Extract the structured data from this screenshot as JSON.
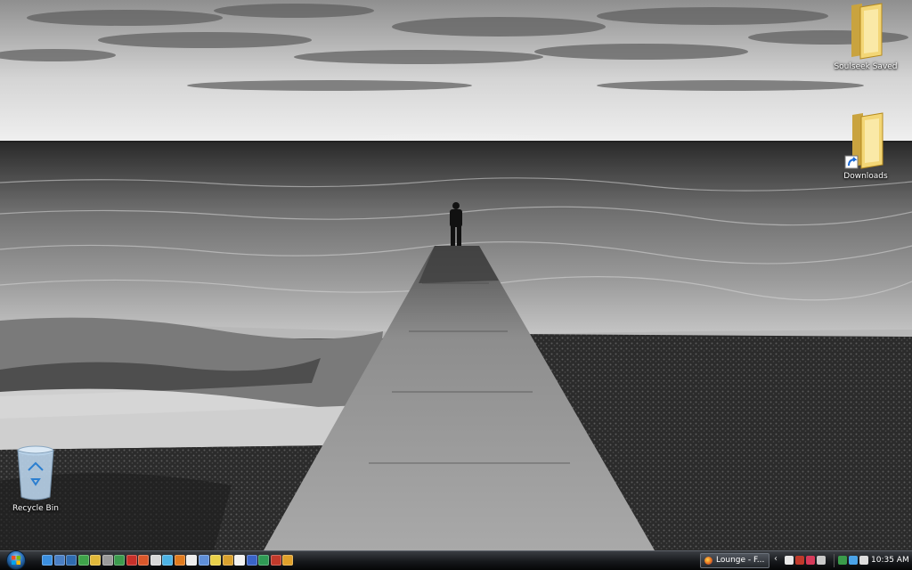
{
  "desktop": {
    "icons": [
      {
        "label": "Soulseek Saved",
        "icon": "folder-icon"
      },
      {
        "label": "Downloads",
        "icon": "folder-shortcut-icon"
      },
      {
        "label": "Recycle Bin",
        "icon": "recycle-bin-icon"
      }
    ]
  },
  "taskbar": {
    "start_icon": "windows-logo-icon",
    "quick_launch": [
      "internet-explorer-icon",
      "show-desktop-icon",
      "media-player-icon",
      "app-icon",
      "app-icon",
      "app-icon",
      "app-icon",
      "app-icon",
      "app-icon",
      "app-icon",
      "app-icon",
      "app-icon",
      "app-icon",
      "app-icon",
      "app-icon",
      "app-icon",
      "app-icon",
      "app-icon",
      "app-icon",
      "app-icon",
      "app-icon"
    ],
    "task_button_label": "Lounge - F...",
    "tray_icons": [
      "zonealarm-icon",
      "app-icon",
      "app-icon",
      "app-icon",
      "app-icon",
      "network-icon",
      "volume-icon"
    ],
    "clock": "10:35 AM"
  }
}
